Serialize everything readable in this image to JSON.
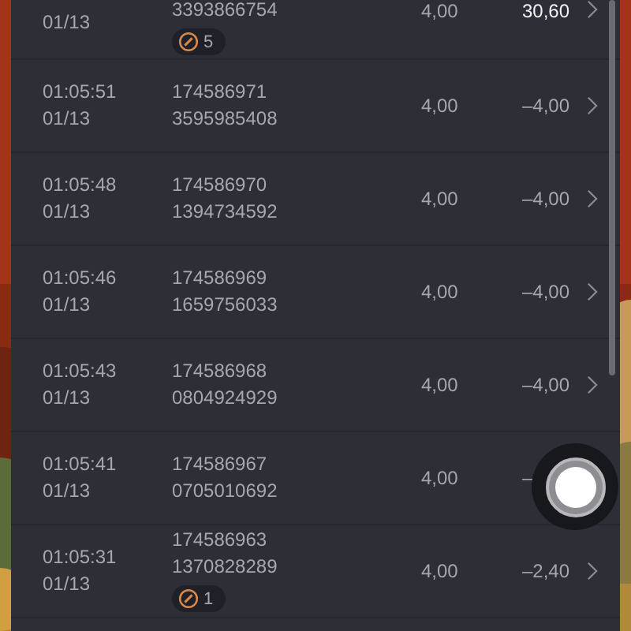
{
  "rows": [
    {
      "time": "",
      "date": "01/13",
      "order": "",
      "serial": "3393866754",
      "quantity": "4,00",
      "amount": "30,60",
      "highlight": true,
      "chevron": true,
      "badge": "5"
    },
    {
      "time": "01:05:51",
      "date": "01/13",
      "order": "174586971",
      "serial": "3595985408",
      "quantity": "4,00",
      "amount": "–4,00",
      "highlight": false,
      "chevron": true
    },
    {
      "time": "01:05:48",
      "date": "01/13",
      "order": "174586970",
      "serial": "1394734592",
      "quantity": "4,00",
      "amount": "–4,00",
      "highlight": false,
      "chevron": true
    },
    {
      "time": "01:05:46",
      "date": "01/13",
      "order": "174586969",
      "serial": "1659756033",
      "quantity": "4,00",
      "amount": "–4,00",
      "highlight": false,
      "chevron": true
    },
    {
      "time": "01:05:43",
      "date": "01/13",
      "order": "174586968",
      "serial": "0804924929",
      "quantity": "4,00",
      "amount": "–4,00",
      "highlight": false,
      "chevron": true
    },
    {
      "time": "01:05:41",
      "date": "01/13",
      "order": "174586967",
      "serial": "0705010692",
      "quantity": "4,00",
      "amount": "–",
      "highlight": false,
      "chevron": false
    },
    {
      "time": "01:05:31",
      "date": "01/13",
      "order": "174586963",
      "serial": "1370828289",
      "quantity": "4,00",
      "amount": "–2,40",
      "highlight": false,
      "chevron": true,
      "badge": "1"
    }
  ]
}
